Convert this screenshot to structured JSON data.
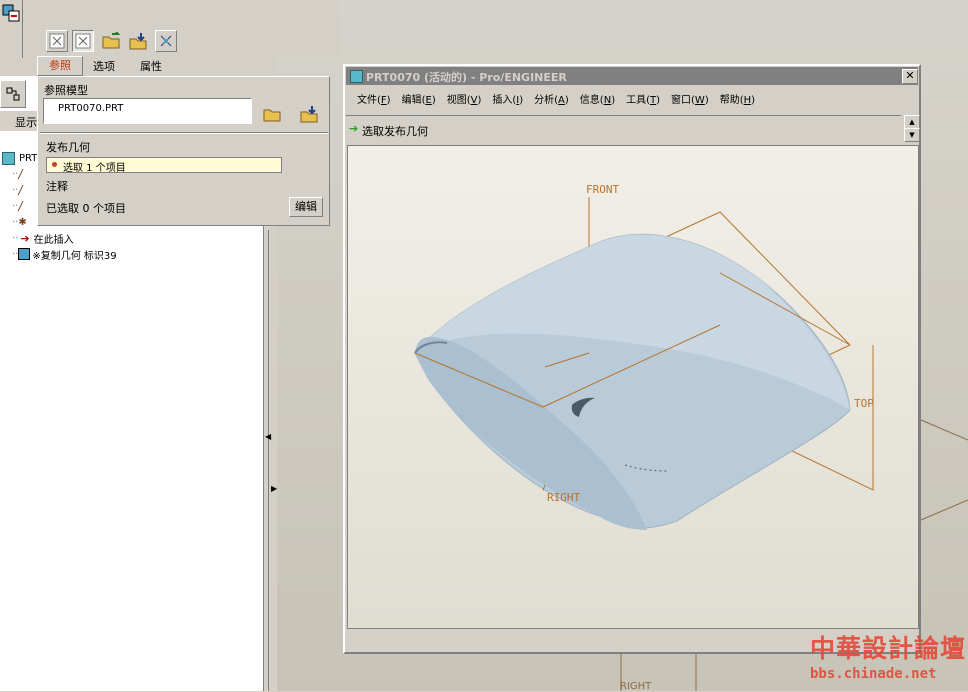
{
  "dashboard": {
    "tabs": [
      {
        "label": "参照"
      },
      {
        "label": "选项"
      },
      {
        "label": "属性"
      }
    ],
    "side_tab": "显示",
    "ref_model_label": "参照模型",
    "ref_model_value": "PRT0070.PRT",
    "publish_geom_label": "发布几何",
    "publish_geom_value": "选取 1 个项目",
    "notes_label": "注释",
    "notes_value": "已选取 0 个项目",
    "edit_button": "编辑"
  },
  "tree": {
    "root_label": "PRT",
    "insert_here": "在此插入",
    "copy_geom": "※复制几何 标识39"
  },
  "window": {
    "title": "PRT0070 (活动的) - Pro/ENGINEER",
    "menus": [
      {
        "label": "文件",
        "key": "F"
      },
      {
        "label": "编辑",
        "key": "E"
      },
      {
        "label": "视图",
        "key": "V"
      },
      {
        "label": "插入",
        "key": "I"
      },
      {
        "label": "分析",
        "key": "A"
      },
      {
        "label": "信息",
        "key": "N"
      },
      {
        "label": "工具",
        "key": "T"
      },
      {
        "label": "窗口",
        "key": "W"
      },
      {
        "label": "帮助",
        "key": "H"
      }
    ],
    "prompt": "选取发布几何"
  },
  "datums": {
    "front": "FRONT",
    "top": "TOP",
    "right": "RIGHT",
    "right_bg": "RIGHT"
  },
  "watermark": {
    "title": "中華設計論壇",
    "url": "bbs.chinade.net"
  },
  "colors": {
    "accent_orange": "#b8742a",
    "title_bar": "#808080",
    "surface_blue": "#b9cbd9"
  }
}
